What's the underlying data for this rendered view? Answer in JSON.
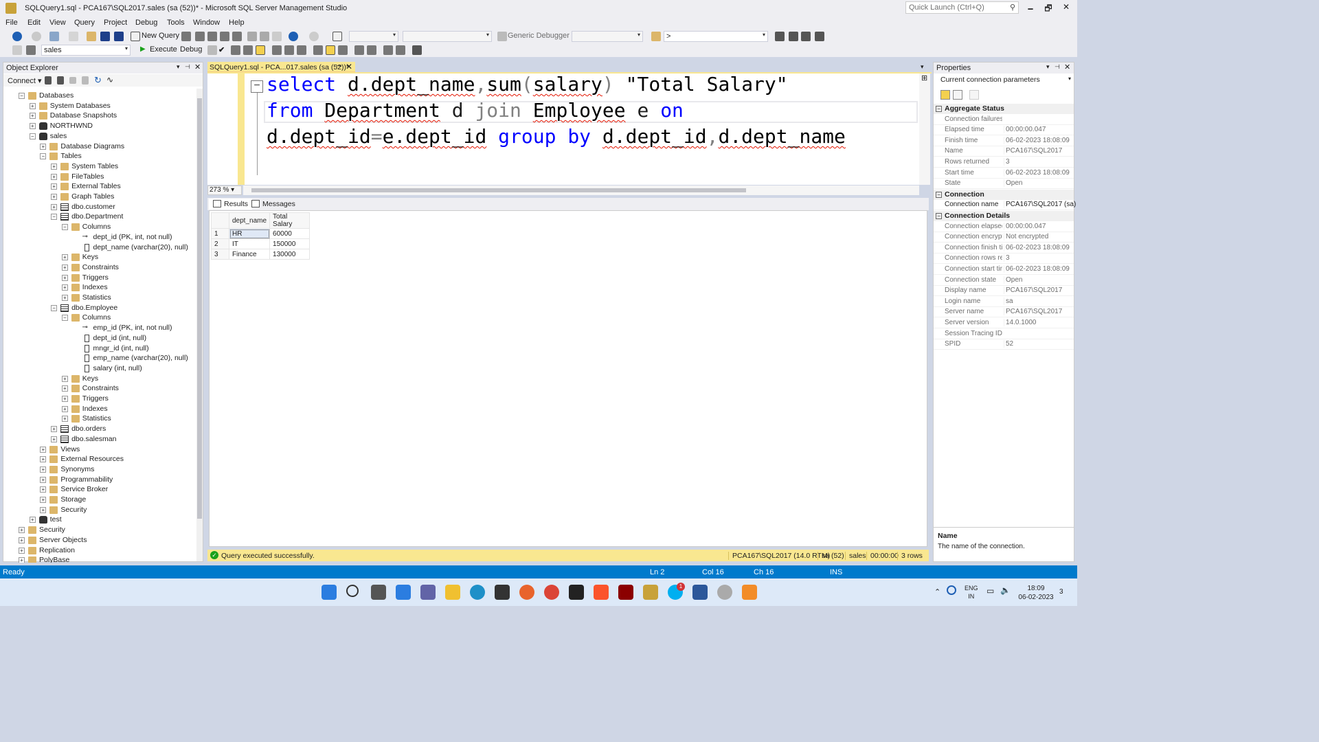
{
  "window": {
    "title": "SQLQuery1.sql - PCA167\\SQL2017.sales (sa (52))* - Microsoft SQL Server Management Studio",
    "quick_launch_placeholder": "Quick Launch (Ctrl+Q)",
    "minimize": "🗕",
    "restore": "🗗",
    "close": "✕"
  },
  "menu": [
    "File",
    "Edit",
    "View",
    "Query",
    "Project",
    "Debug",
    "Tools",
    "Window",
    "Help"
  ],
  "toolbar1": {
    "new_query": "New Query",
    "debugger": "Generic Debugger",
    "find_value": ">"
  },
  "toolbar2": {
    "database": "sales",
    "execute": "Execute",
    "debug": "Debug"
  },
  "object_explorer": {
    "title": "Object Explorer",
    "connect": "Connect",
    "tree": [
      {
        "label": "Databases",
        "exp": "−",
        "icon": "folder"
      },
      {
        "label": "System Databases",
        "exp": "+",
        "icon": "folder"
      },
      {
        "label": "Database Snapshots",
        "exp": "+",
        "icon": "folder"
      },
      {
        "label": "NORTHWND",
        "exp": "+",
        "icon": "db"
      },
      {
        "label": "sales",
        "exp": "−",
        "icon": "db"
      },
      {
        "label": "Database Diagrams",
        "exp": "+",
        "icon": "folder"
      },
      {
        "label": "Tables",
        "exp": "−",
        "icon": "folder"
      },
      {
        "label": "System Tables",
        "exp": "+",
        "icon": "folder"
      },
      {
        "label": "FileTables",
        "exp": "+",
        "icon": "folder"
      },
      {
        "label": "External Tables",
        "exp": "+",
        "icon": "folder"
      },
      {
        "label": "Graph Tables",
        "exp": "+",
        "icon": "folder"
      },
      {
        "label": "dbo.customer",
        "exp": "+",
        "icon": "table"
      },
      {
        "label": "dbo.Department",
        "exp": "−",
        "icon": "table"
      },
      {
        "label": "Columns",
        "exp": "−",
        "icon": "folder"
      },
      {
        "label": "dept_id (PK, int, not null)",
        "exp": "",
        "icon": "key"
      },
      {
        "label": "dept_name (varchar(20), null)",
        "exp": "",
        "icon": "column"
      },
      {
        "label": "Keys",
        "exp": "+",
        "icon": "folder"
      },
      {
        "label": "Constraints",
        "exp": "+",
        "icon": "folder"
      },
      {
        "label": "Triggers",
        "exp": "+",
        "icon": "folder"
      },
      {
        "label": "Indexes",
        "exp": "+",
        "icon": "folder"
      },
      {
        "label": "Statistics",
        "exp": "+",
        "icon": "folder"
      },
      {
        "label": "dbo.Employee",
        "exp": "−",
        "icon": "table"
      },
      {
        "label": "Columns",
        "exp": "−",
        "icon": "folder"
      },
      {
        "label": "emp_id (PK, int, not null)",
        "exp": "",
        "icon": "key"
      },
      {
        "label": "dept_id (int, null)",
        "exp": "",
        "icon": "column"
      },
      {
        "label": "mngr_id (int, null)",
        "exp": "",
        "icon": "column"
      },
      {
        "label": "emp_name (varchar(20), null)",
        "exp": "",
        "icon": "column"
      },
      {
        "label": "salary (int, null)",
        "exp": "",
        "icon": "column"
      },
      {
        "label": "Keys",
        "exp": "+",
        "icon": "folder"
      },
      {
        "label": "Constraints",
        "exp": "+",
        "icon": "folder"
      },
      {
        "label": "Triggers",
        "exp": "+",
        "icon": "folder"
      },
      {
        "label": "Indexes",
        "exp": "+",
        "icon": "folder"
      },
      {
        "label": "Statistics",
        "exp": "+",
        "icon": "folder"
      },
      {
        "label": "dbo.orders",
        "exp": "+",
        "icon": "table"
      },
      {
        "label": "dbo.salesman",
        "exp": "+",
        "icon": "table"
      },
      {
        "label": "Views",
        "exp": "+",
        "icon": "folder"
      },
      {
        "label": "External Resources",
        "exp": "+",
        "icon": "folder"
      },
      {
        "label": "Synonyms",
        "exp": "+",
        "icon": "folder"
      },
      {
        "label": "Programmability",
        "exp": "+",
        "icon": "folder"
      },
      {
        "label": "Service Broker",
        "exp": "+",
        "icon": "folder"
      },
      {
        "label": "Storage",
        "exp": "+",
        "icon": "folder"
      },
      {
        "label": "Security",
        "exp": "+",
        "icon": "folder"
      },
      {
        "label": "test",
        "exp": "+",
        "icon": "db"
      },
      {
        "label": "Security",
        "exp": "+",
        "icon": "folder"
      },
      {
        "label": "Server Objects",
        "exp": "+",
        "icon": "folder"
      },
      {
        "label": "Replication",
        "exp": "+",
        "icon": "folder"
      },
      {
        "label": "PolyBase",
        "exp": "+",
        "icon": "folder"
      }
    ]
  },
  "editor": {
    "tab_title": "SQLQuery1.sql - PCA...017.sales (sa (52))*",
    "zoom": "273 %",
    "line1": {
      "select": "select",
      "col1": "d.dept_name",
      "comma": ",",
      "sum": "sum",
      "paren_open": "(",
      "salary": "salary",
      "paren_close": ")",
      "alias": "\"Total Salary\""
    },
    "line2": {
      "from": "from",
      "tbl1": "Department",
      "a1": "d",
      "join": "join",
      "tbl2": "Employee",
      "a2": "e",
      "on": "on"
    },
    "line3": {
      "left": "d.dept_id",
      "eq": "=",
      "right": "e.dept_id",
      "group": "group",
      "by": "by",
      "g1": "d.dept_id",
      "comma": ",",
      "g2": "d.dept_name"
    }
  },
  "results": {
    "tab_results": "Results",
    "tab_messages": "Messages",
    "columns": [
      "dept_name",
      "Total Salary"
    ],
    "rows": [
      {
        "n": "1",
        "dept_name": "HR",
        "total": "60000"
      },
      {
        "n": "2",
        "dept_name": "IT",
        "total": "150000"
      },
      {
        "n": "3",
        "dept_name": "Finance",
        "total": "130000"
      }
    ]
  },
  "query_status": {
    "message": "Query executed successfully.",
    "server": "PCA167\\SQL2017 (14.0 RTM)",
    "user": "sa (52)",
    "db": "sales",
    "time": "00:00:00",
    "rows": "3 rows"
  },
  "properties": {
    "title": "Properties",
    "selector": "Current connection parameters",
    "categories": [
      {
        "name": "Aggregate Status",
        "rows": [
          {
            "k": "Connection failures",
            "v": ""
          },
          {
            "k": "Elapsed time",
            "v": "00:00:00.047"
          },
          {
            "k": "Finish time",
            "v": "06-02-2023 18:08:09"
          },
          {
            "k": "Name",
            "v": "PCA167\\SQL2017"
          },
          {
            "k": "Rows returned",
            "v": "3"
          },
          {
            "k": "Start time",
            "v": "06-02-2023 18:08:09"
          },
          {
            "k": "State",
            "v": "Open"
          }
        ]
      },
      {
        "name": "Connection",
        "rows": [
          {
            "k": "Connection name",
            "v": "PCA167\\SQL2017 (sa)",
            "dark": true
          }
        ]
      },
      {
        "name": "Connection Details",
        "rows": [
          {
            "k": "Connection elapsed",
            "v": "00:00:00.047"
          },
          {
            "k": "Connection encryption",
            "v": "Not encrypted"
          },
          {
            "k": "Connection finish time",
            "v": "06-02-2023 18:08:09"
          },
          {
            "k": "Connection rows returned",
            "v": "3"
          },
          {
            "k": "Connection start time",
            "v": "06-02-2023 18:08:09"
          },
          {
            "k": "Connection state",
            "v": "Open"
          },
          {
            "k": "Display name",
            "v": "PCA167\\SQL2017"
          },
          {
            "k": "Login name",
            "v": "sa"
          },
          {
            "k": "Server name",
            "v": "PCA167\\SQL2017"
          },
          {
            "k": "Server version",
            "v": "14.0.1000"
          },
          {
            "k": "Session Tracing ID",
            "v": ""
          },
          {
            "k": "SPID",
            "v": "52"
          }
        ]
      }
    ],
    "desc_name": "Name",
    "desc_text": "The name of the connection."
  },
  "statusbar": {
    "ready": "Ready",
    "ln": "Ln 2",
    "col": "Col 16",
    "ch": "Ch 16",
    "ins": "INS"
  },
  "taskbar": {
    "lang1": "ENG",
    "lang2": "IN",
    "time": "18:09",
    "date": "06-02-2023",
    "notif": "3",
    "badge": "1"
  },
  "colors": {
    "accent": "#007acc",
    "tab_yellow": "#f9e790",
    "keyword": "#0000ff",
    "function": "#ff00ff",
    "string": "#a31515"
  }
}
